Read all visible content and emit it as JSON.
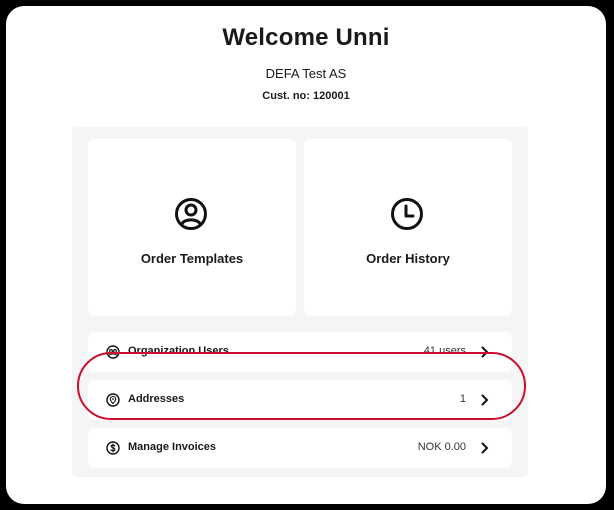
{
  "header": {
    "welcome": "Welcome Unni",
    "company": "DEFA Test AS",
    "customer_number": "Cust. no: 120001"
  },
  "cards": [
    {
      "label": "Order Templates",
      "icon": "user-circle-icon"
    },
    {
      "label": "Order History",
      "icon": "clock-icon"
    }
  ],
  "rows": [
    {
      "label": "Organization Users",
      "value": "41 users",
      "icon": "users-group-icon"
    },
    {
      "label": "Addresses",
      "value": "1",
      "icon": "location-pin-icon"
    },
    {
      "label": "Manage Invoices",
      "value": "NOK 0.00",
      "icon": "dollar-circle-icon"
    }
  ],
  "colors": {
    "highlight": "#c8102e",
    "panel_background": "#f5f5f5",
    "text": "#1a1a1a"
  }
}
